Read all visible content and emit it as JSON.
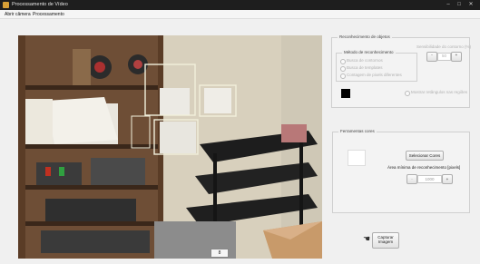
{
  "window": {
    "title": "Processamento de Vídeo"
  },
  "menu": {
    "items": [
      "Abrir câmera",
      "Processamento"
    ]
  },
  "camera": {
    "counter": "8"
  },
  "detection_panel": {
    "title": "Reconhecimento de objetos",
    "method_group_label": "Método de reconhecimento",
    "methods": [
      "Busca de contornos",
      "Busca de templates",
      "Contagem de pixels diferentes"
    ],
    "threshold_label": "Sensibilidade do contorno (%)",
    "threshold_value": "50",
    "show_option": "Mostrar retângulos nas regiões"
  },
  "color_panel": {
    "title": "Ferramentas cores",
    "select_color_button": "Selecionar Cores",
    "tolerance_label": "Área mínima de reconhecimento [pixels]",
    "tolerance_value": "1000"
  },
  "capture": {
    "button_line1": "Capturar",
    "button_line2": "Imagem"
  }
}
